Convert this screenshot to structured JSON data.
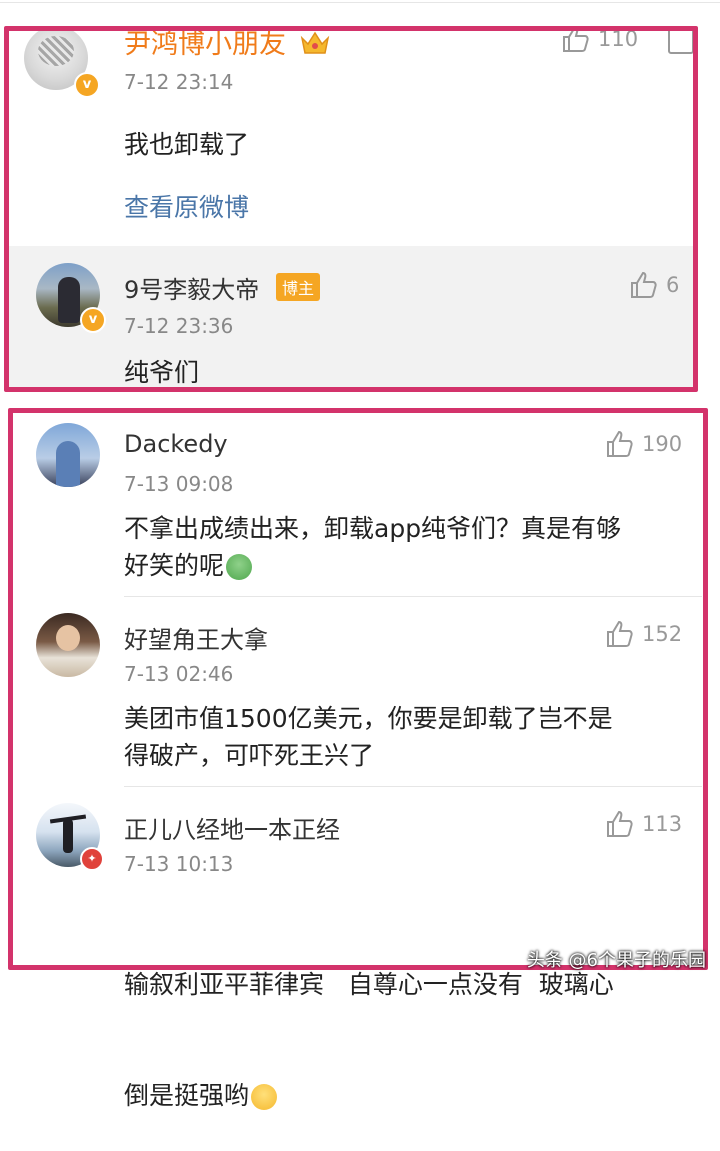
{
  "comment_top": {
    "author": "尹鸿博小朋友",
    "time": "7-12 23:14",
    "text": "我也卸载了",
    "likes": "110",
    "view_original": "查看原微博"
  },
  "reply_top": {
    "author": "9号李毅大帝",
    "badge": "博主",
    "time": "7-12 23:36",
    "text": "纯爷们",
    "likes": "6"
  },
  "comments": [
    {
      "author": "Dackedy",
      "time": "7-13 09:08",
      "text_line1": "不拿出成绩出来，卸载app纯爷们？真是有够",
      "text_line2": "好笑的呢",
      "likes": "190"
    },
    {
      "author": "好望角王大拿",
      "time": "7-13 02:46",
      "text_line1": "美团市值1500亿美元，你要是卸载了岂不是",
      "text_line2": "得破产，可吓死王兴了",
      "likes": "152"
    },
    {
      "author": "正儿八经地一本正经",
      "time": "7-13 10:13",
      "text_line1": "输叙利亚平菲律宾   自尊心一点没有  玻璃心",
      "text_line2": "倒是挺强哟",
      "likes": "113"
    }
  ],
  "watermark": "头条 @6个果子的乐园",
  "colors": {
    "highlight_border": "#d3336b",
    "vip_name": "#f07b1a",
    "link": "#4a76a8",
    "badge": "#f5a623"
  }
}
